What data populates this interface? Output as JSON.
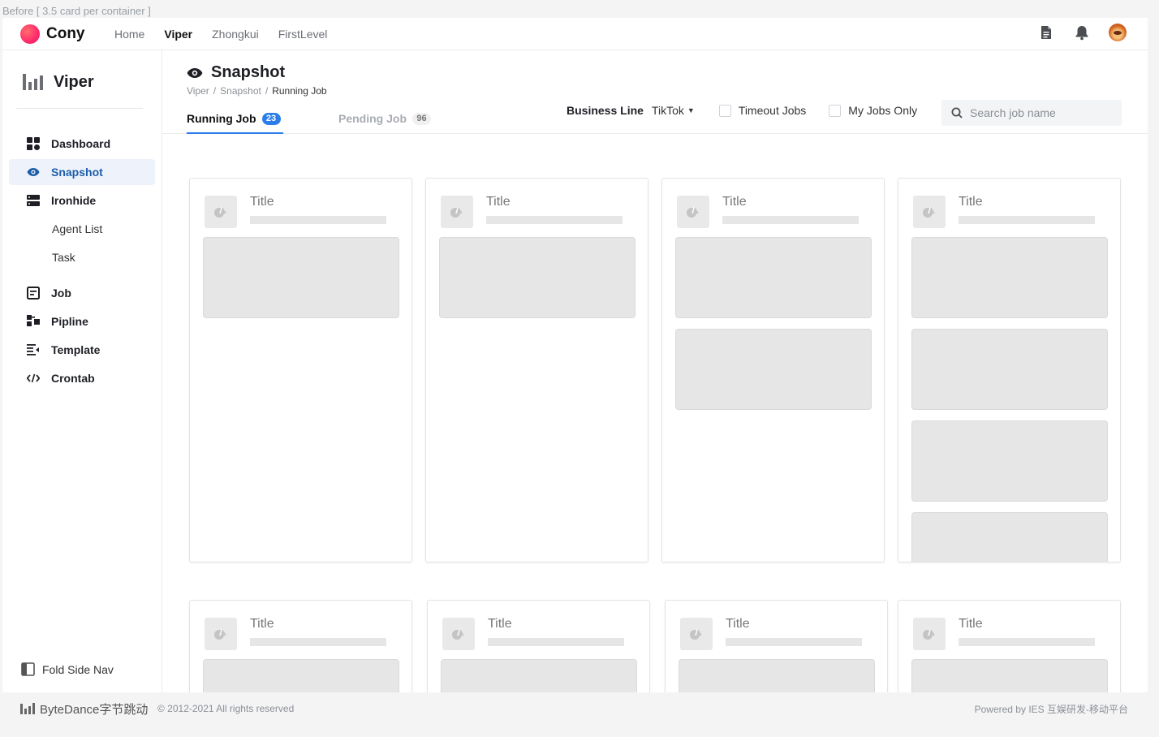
{
  "caption": "Before [ 3.5 card per container ]",
  "topbar": {
    "brand": "Cony",
    "nav": [
      {
        "label": "Home",
        "active": false
      },
      {
        "label": "Viper",
        "active": true
      },
      {
        "label": "Zhongkui",
        "active": false
      },
      {
        "label": "FirstLevel",
        "active": false
      }
    ],
    "icons": [
      "document-icon",
      "bell-icon",
      "avatar"
    ]
  },
  "sidebar": {
    "app_name": "Viper",
    "items": [
      {
        "label": "Dashboard",
        "icon": "dashboard-icon"
      },
      {
        "label": "Snapshot",
        "icon": "eye-icon",
        "active": true
      },
      {
        "label": "Ironhide",
        "icon": "server-icon"
      },
      {
        "label": "Agent List"
      },
      {
        "label": "Task"
      },
      {
        "label": "Job",
        "icon": "job-icon"
      },
      {
        "label": "Pipline",
        "icon": "pipeline-icon"
      },
      {
        "label": "Template",
        "icon": "template-icon"
      },
      {
        "label": "Crontab",
        "icon": "code-icon"
      }
    ],
    "fold_label": "Fold Side Nav"
  },
  "page": {
    "title": "Snapshot",
    "breadcrumb": [
      "Viper",
      "Snapshot",
      "Running Job"
    ],
    "tabs": [
      {
        "label": "Running Job",
        "count": "23",
        "active": true
      },
      {
        "label": "Pending Job",
        "count": "96",
        "active": false
      }
    ],
    "filters": {
      "business_line_label": "Business Line",
      "business_line_value": "TikTok",
      "timeout_label": "Timeout Jobs",
      "my_jobs_label": "My Jobs Only",
      "search_placeholder": "Search job name"
    }
  },
  "cards": [
    {
      "title": "Title",
      "placeholders": 1
    },
    {
      "title": "Title",
      "placeholders": 1
    },
    {
      "title": "Title",
      "placeholders": 2
    },
    {
      "title": "Title",
      "placeholders": 4
    },
    {
      "title": "Title",
      "placeholders": 1
    },
    {
      "title": "Title",
      "placeholders": 1
    },
    {
      "title": "Title",
      "placeholders": 1
    },
    {
      "title": "Title",
      "placeholders": 1
    }
  ],
  "footer": {
    "brand": "ByteDance字节跳动",
    "copyright": "© 2012-2021 All rights reserved",
    "powered": "Powered by IES 互娱研发-移动平台"
  }
}
